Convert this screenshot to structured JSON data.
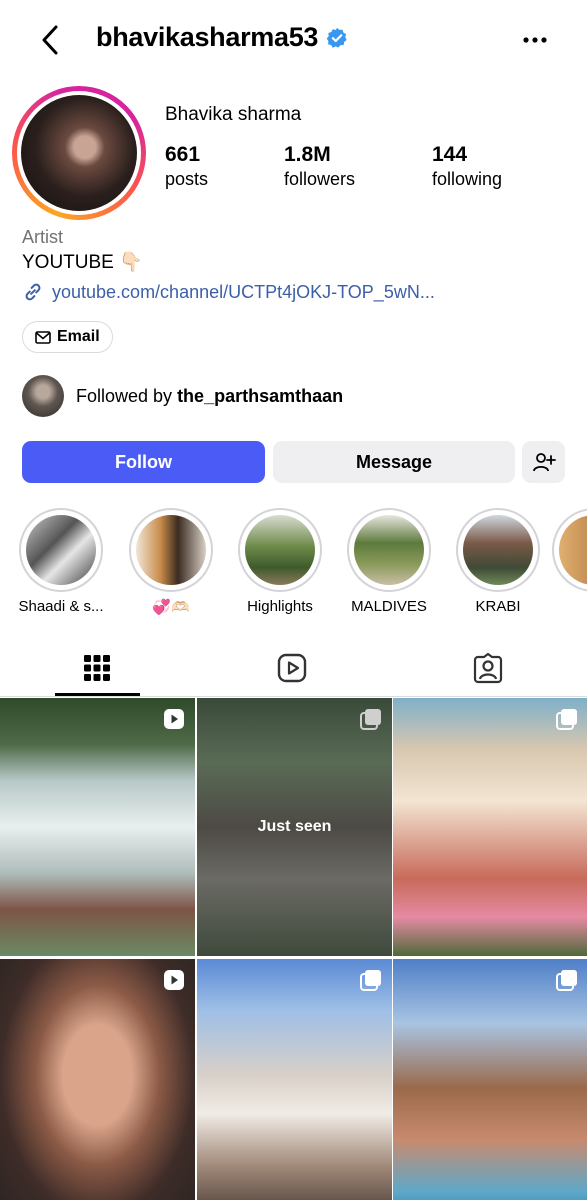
{
  "header": {
    "username": "bhavikasharma53"
  },
  "profile": {
    "full_name": "Bhavika sharma",
    "stats": [
      {
        "value": "661",
        "label": "posts"
      },
      {
        "value": "1.8M",
        "label": "followers"
      },
      {
        "value": "144",
        "label": "following"
      }
    ],
    "category": "Artist",
    "bio": "YOUTUBE 👇🏻",
    "link": "youtube.com/channel/UCTPt4jOKJ-TOP_5wN...",
    "email_label": "Email",
    "followed_by_prefix": "Followed by ",
    "followed_by_user": "the_parthsamthaan"
  },
  "actions": {
    "follow": "Follow",
    "message": "Message"
  },
  "highlights": [
    {
      "label": "Shaadi & s..."
    },
    {
      "label": "💞🫶🏻"
    },
    {
      "label": "Highlights"
    },
    {
      "label": "MALDIVES"
    },
    {
      "label": "KRABI"
    }
  ],
  "grid": {
    "overlay_text": "Just seen"
  },
  "colors": {
    "follow_button": "#4a5cf5",
    "link": "#3b5fa8",
    "verified": "#3897f0"
  }
}
